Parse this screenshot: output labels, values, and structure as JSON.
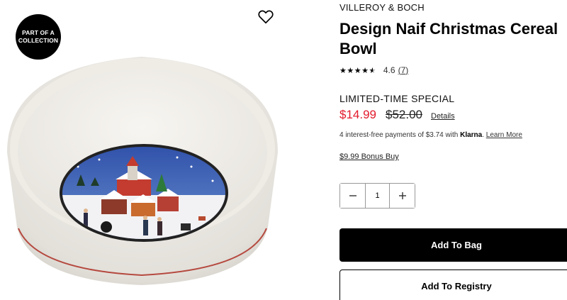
{
  "image": {
    "badge_line1": "PART OF A",
    "badge_line2": "COLLECTION",
    "wishlist_icon": "heart-outline-icon"
  },
  "product": {
    "brand": "VILLEROY & BOCH",
    "title": "Design Naif Christmas Cereal Bowl",
    "rating": {
      "stars_icon": "star-icon",
      "star_count": 4.5,
      "value": "4.6",
      "count": "7"
    },
    "special_label": "LIMITED-TIME SPECIAL",
    "sale_price": "$14.99",
    "original_price": "$52.00",
    "details_link": "Details",
    "klarna": {
      "prefix": "4 interest-free payments of $3.74 with ",
      "brand": "Klarna",
      "suffix": ". ",
      "learn_more": "Learn More"
    },
    "bonus_buy": "$9.99 Bonus Buy",
    "quantity": {
      "minus_icon": "minus-icon",
      "value": "1",
      "plus_icon": "plus-icon"
    },
    "add_to_bag": "Add To Bag",
    "add_to_registry": "Add To Registry"
  },
  "colors": {
    "sale_red": "#e21a2c",
    "primary_button": "#000000"
  }
}
